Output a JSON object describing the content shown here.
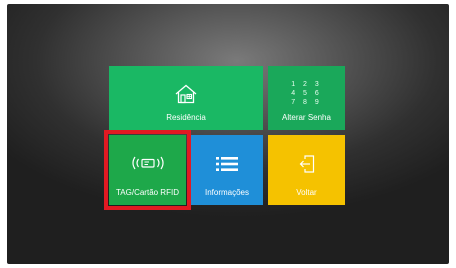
{
  "tiles": {
    "residencia": {
      "label": "Residência",
      "icon": "house-icon",
      "color": "#1ab864"
    },
    "alterar_senha": {
      "label": "Alterar Senha",
      "icon": "keypad-icon",
      "color": "#1aa85a",
      "keypad_rows": [
        "1 2 3",
        "4 5 6",
        "7 8 9"
      ]
    },
    "tag": {
      "label": "TAG/Cartão RFID",
      "icon": "rfid-card-icon",
      "color": "#1ea84a",
      "selected": true
    },
    "informacoes": {
      "label": "Informações",
      "icon": "list-icon",
      "color": "#1f8fd8"
    },
    "voltar": {
      "label": "Voltar",
      "icon": "exit-icon",
      "color": "#f5c200"
    }
  },
  "highlight_color": "#e11a22"
}
